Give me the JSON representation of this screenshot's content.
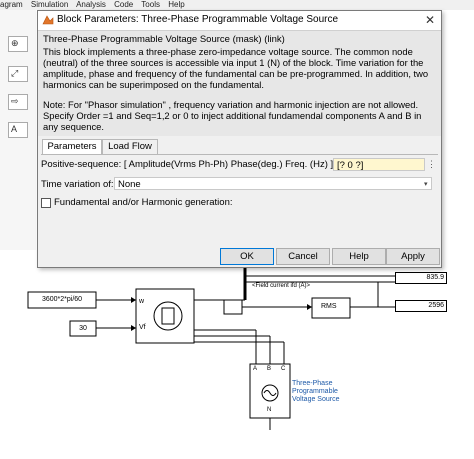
{
  "background": {
    "menu": [
      "agram",
      "Simulation",
      "Analysis",
      "Code",
      "Tools",
      "Help"
    ],
    "const_block_1": "3600*2*pi/60",
    "const_block_2": "30",
    "rms_label": "RMS",
    "display_1": "835.9",
    "display_2": "2596",
    "field_current_label": "<Field current  ifd (A)>",
    "port_w": "w",
    "port_vf": "Vf",
    "source_block_label": "Three-Phase\nProgrammable\nVoltage Source",
    "source_ports": [
      "A",
      "B",
      "C"
    ],
    "source_neutral": "N"
  },
  "dialog": {
    "title": "Block Parameters: Three-Phase Programmable Voltage Source",
    "heading": "Three-Phase Programmable Voltage Source (mask) (link)",
    "description": "This block implements a three-phase zero-impedance voltage source. The common node (neutral) of the three sources is accessible via input 1 (N) of the block. Time variation for the amplitude, phase and frequency of the fundamental can be pre-programmed. In addition, two harmonics can be superimposed on the fundamental.",
    "note": "Note: For  \"Phasor simulation\" , frequency variation and harmonic injection are not allowed. Specify  Order =1 and Seq=1,2 or 0 to inject additional fundamendal components A and B in any sequence.",
    "tabs": [
      "Parameters",
      "Load Flow"
    ],
    "active_tab": "Parameters",
    "positive_sequence_label": "Positive-sequence: [ Amplitude(Vrms Ph-Ph)  Phase(deg.)  Freq. (Hz) ]",
    "positive_sequence_value": "[? 0 ?]",
    "time_variation_label": "Time variation of:",
    "time_variation_value": "None",
    "harmonic_label": "Fundamental and/or Harmonic generation:",
    "buttons": {
      "ok": "OK",
      "cancel": "Cancel",
      "help": "Help",
      "apply": "Apply"
    }
  }
}
